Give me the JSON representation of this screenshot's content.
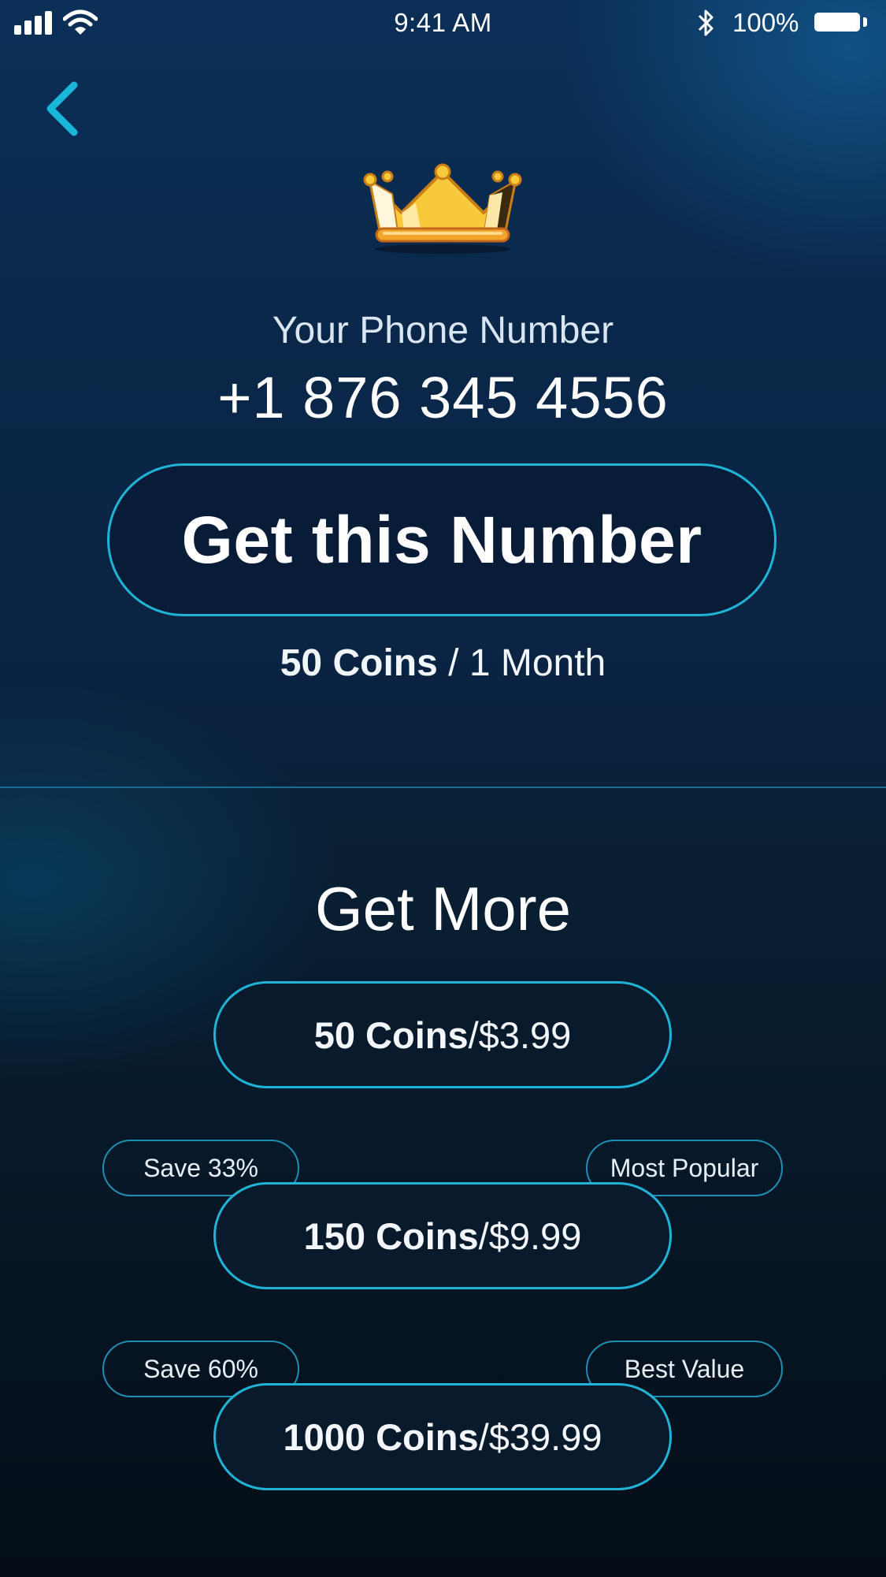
{
  "status_bar": {
    "time": "9:41 AM",
    "battery": "100%"
  },
  "icons": {
    "back": "chevron-left-icon",
    "crown": "crown-icon",
    "signal": "signal-icon",
    "wifi": "wifi-icon",
    "bluetooth": "bluetooth-icon",
    "battery": "battery-icon"
  },
  "colors": {
    "accent": "#1fb3d6",
    "background_top": "#0b2f57",
    "background_bottom": "#050e18"
  },
  "header": {
    "label": "Your Phone Number",
    "phone_number": "+1 876 345 4556"
  },
  "primary": {
    "button_label": "Get this Number",
    "price_coins": "50 Coins",
    "price_separator": " / ",
    "price_period": "1 Month"
  },
  "get_more": {
    "title": "Get More",
    "offers": [
      {
        "coins": "50 Coins",
        "separator": " / ",
        "price": "$3.99",
        "left_tag": "",
        "right_tag": ""
      },
      {
        "coins": "150 Coins",
        "separator": " / ",
        "price": "$9.99",
        "left_tag": "Save 33%",
        "right_tag": "Most Popular"
      },
      {
        "coins": "1000 Coins",
        "separator": " / ",
        "price": "$39.99",
        "left_tag": "Save 60%",
        "right_tag": "Best Value"
      }
    ]
  }
}
